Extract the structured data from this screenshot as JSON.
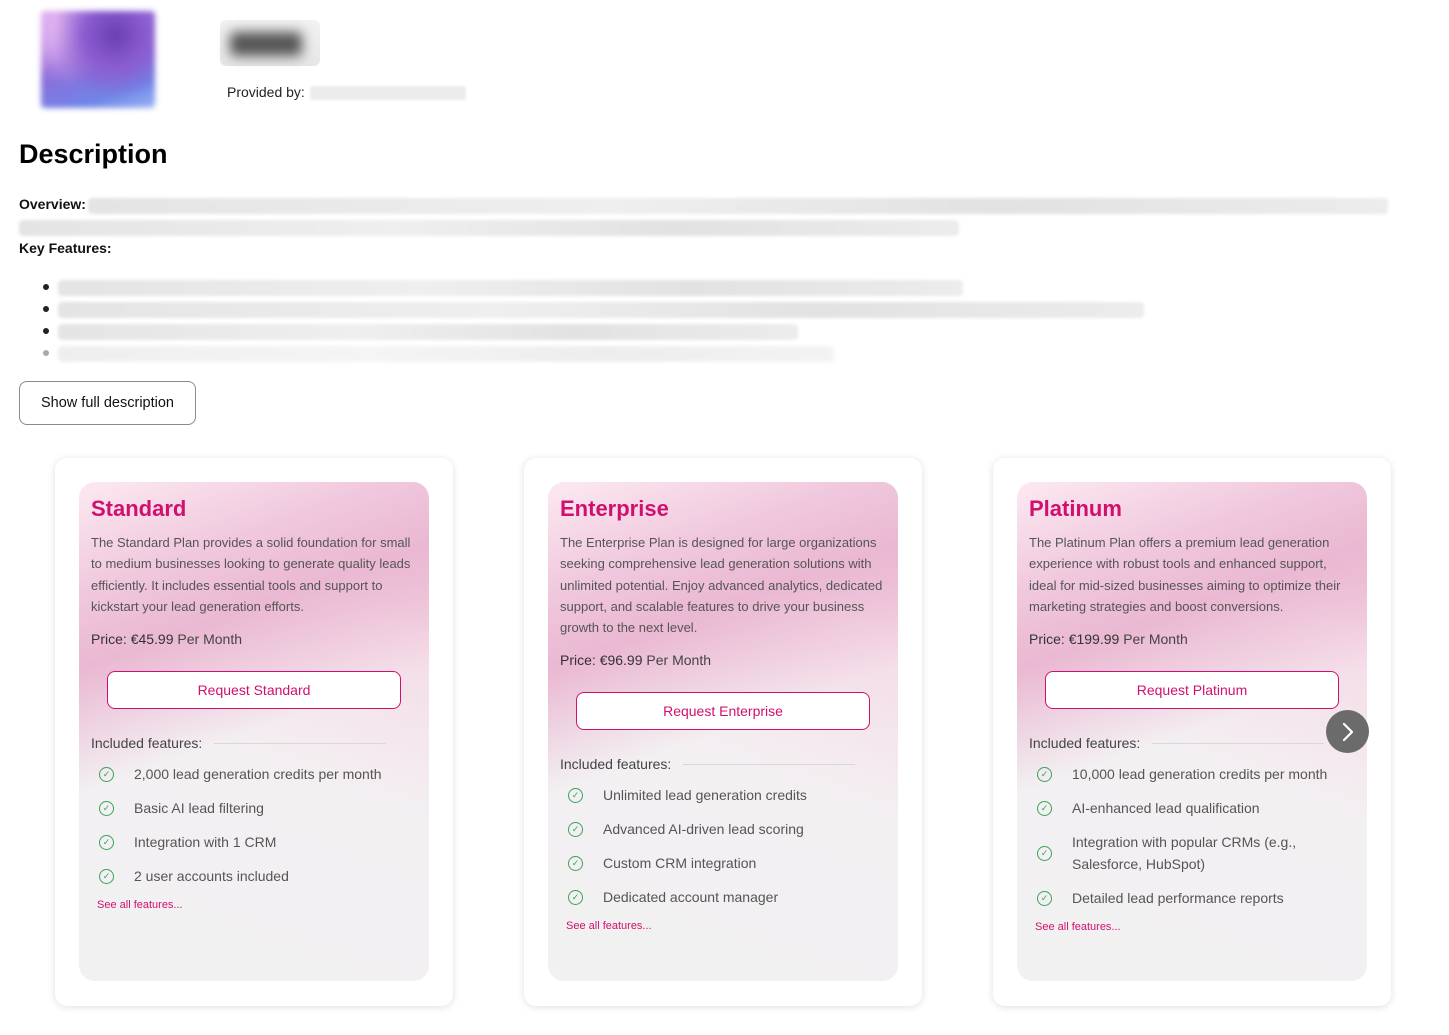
{
  "header": {
    "provided_by_label": "Provided by:"
  },
  "description": {
    "title": "Description",
    "overview_label": "Overview:",
    "key_features_label": "Key Features:",
    "show_full_button": "Show full description"
  },
  "plans": [
    {
      "name": "Standard",
      "description": "The Standard Plan provides a solid foundation for small to medium businesses looking to generate quality leads efficiently. It includes essential tools and support to kickstart your lead generation efforts.",
      "price_label": "Price:",
      "price_value": "€45.99",
      "price_period": "Per Month",
      "button": "Request Standard",
      "included_label": "Included features:",
      "features": [
        "2,000 lead generation credits per month",
        "Basic AI lead filtering",
        "Integration with 1 CRM",
        "2 user accounts included"
      ],
      "see_all": "See all features..."
    },
    {
      "name": "Enterprise",
      "description": "The Enterprise Plan is designed for large organizations seeking comprehensive lead generation solutions with unlimited potential. Enjoy advanced analytics, dedicated support, and scalable features to drive your business growth to the next level.",
      "price_label": "Price:",
      "price_value": "€96.99",
      "price_period": "Per Month",
      "button": "Request Enterprise",
      "included_label": "Included features:",
      "features": [
        "Unlimited lead generation credits",
        "Advanced AI-driven lead scoring",
        "Custom CRM integration",
        "Dedicated account manager"
      ],
      "see_all": "See all features..."
    },
    {
      "name": "Platinum",
      "description": "The Platinum Plan offers a premium lead generation experience with robust tools and enhanced support, ideal for mid-sized businesses aiming to optimize their marketing strategies and boost conversions.",
      "price_label": "Price:",
      "price_value": "€199.99",
      "price_period": "Per Month",
      "button": "Request Platinum",
      "included_label": "Included features:",
      "features": [
        "10,000 lead generation credits per month",
        "AI-enhanced lead qualification",
        "Integration with popular CRMs (e.g., Salesforce, HubSpot)",
        "Detailed lead performance reports"
      ],
      "see_all": "See all features..."
    }
  ],
  "carousel": {
    "next_icon": "chevron-right-icon"
  },
  "colors": {
    "accent": "#d0106f",
    "check": "#3aa35a"
  }
}
